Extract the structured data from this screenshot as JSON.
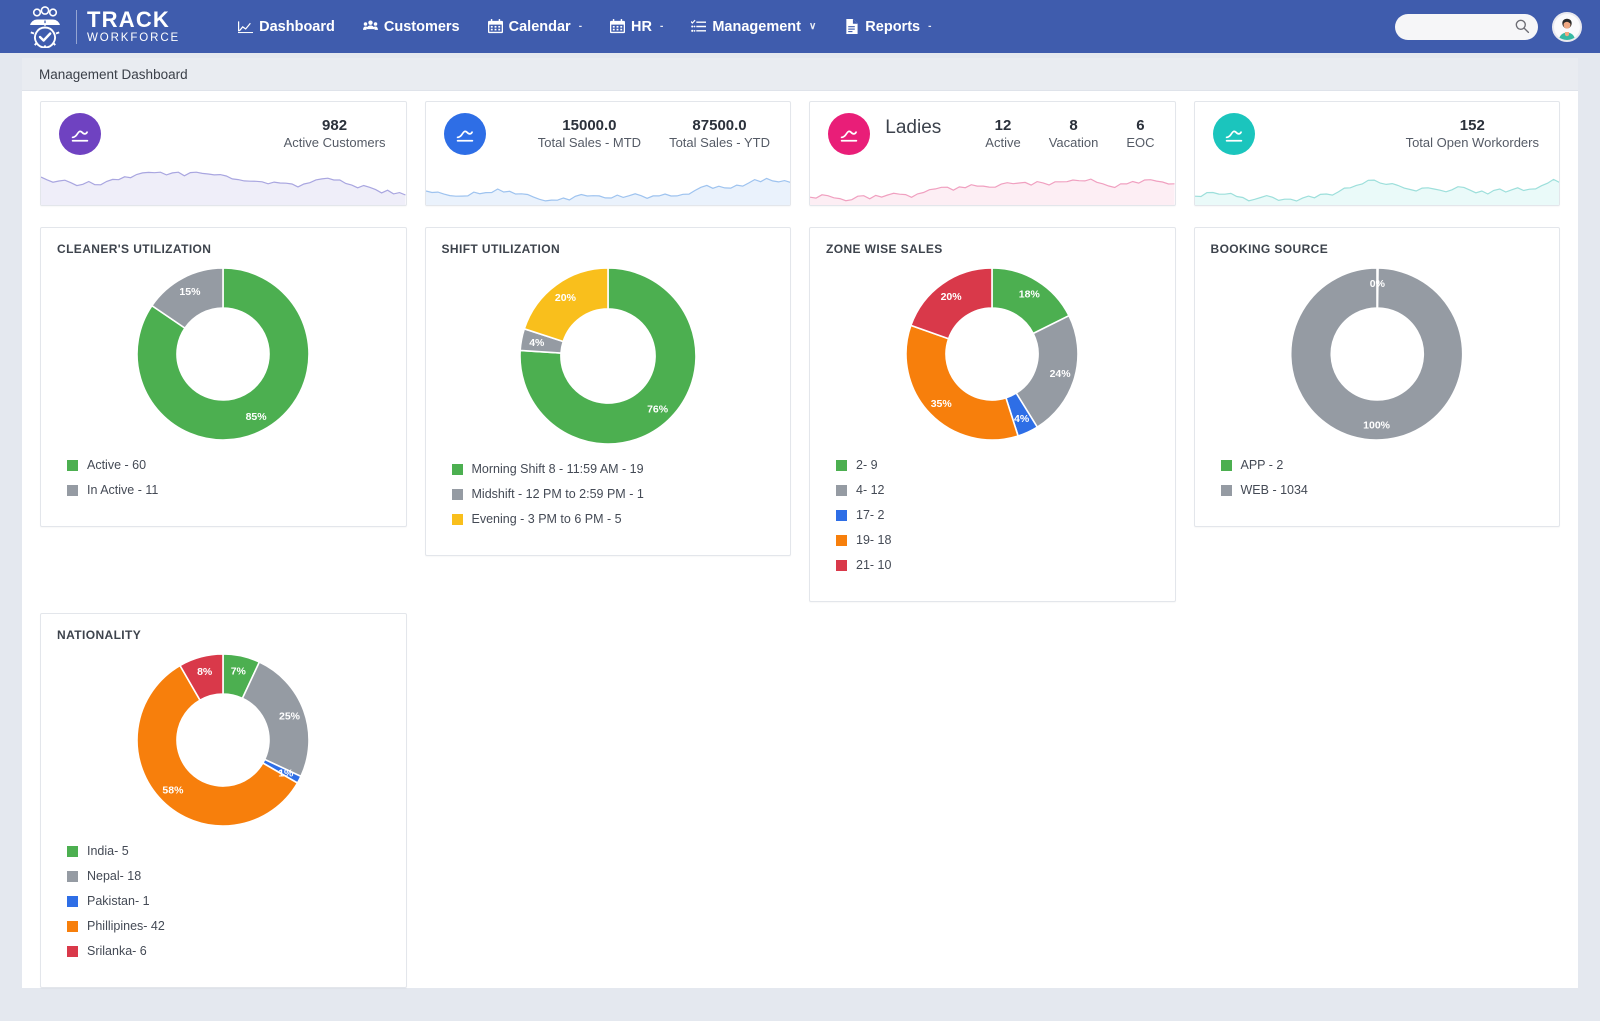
{
  "brand": {
    "icon": "workforce-people-gear-logo",
    "name_top": "TRACK",
    "name_sub": "WORKFORCE"
  },
  "nav": {
    "items": [
      {
        "label": "Dashboard",
        "icon": "chart-line-icon",
        "caret": ""
      },
      {
        "label": "Customers",
        "icon": "users-icon",
        "caret": ""
      },
      {
        "label": "Calendar",
        "icon": "calendar-icon",
        "caret": "-"
      },
      {
        "label": "HR",
        "icon": "calendar-icon",
        "caret": "-"
      },
      {
        "label": "Management",
        "icon": "list-check-icon",
        "caret": "∨"
      },
      {
        "label": "Reports",
        "icon": "file-icon",
        "caret": "-"
      }
    ]
  },
  "search": {
    "value": "",
    "placeholder": "",
    "icon": "search-icon"
  },
  "account": {
    "icon": "user-avatar"
  },
  "page": {
    "title": "Management Dashboard"
  },
  "kpis": [
    {
      "icon": "trend-up-icon",
      "color": "#6f42c1",
      "spark_color": "#a9a6e0",
      "spark_fill": "#efeef9",
      "stats": [
        {
          "value": "982",
          "label": "Active Customers"
        }
      ]
    },
    {
      "icon": "trend-up-icon",
      "color": "#2e6ee6",
      "spark_color": "#9ec3ef",
      "spark_fill": "#eaf2fc",
      "stats": [
        {
          "value": "15000.0",
          "label": "Total Sales - MTD"
        },
        {
          "value": "87500.0",
          "label": "Total Sales - YTD"
        }
      ]
    },
    {
      "icon": "trend-up-icon",
      "color": "#e91e78",
      "spark_color": "#f0a0c0",
      "spark_fill": "#fdeef4",
      "name": "Ladies",
      "stats": [
        {
          "value": "12",
          "label": "Active"
        },
        {
          "value": "8",
          "label": "Vacation"
        },
        {
          "value": "6",
          "label": "EOC"
        }
      ]
    },
    {
      "icon": "trend-up-icon",
      "color": "#1bc5bd",
      "spark_color": "#9ddfdb",
      "spark_fill": "#eafaf9",
      "stats": [
        {
          "value": "152",
          "label": "Total Open Workorders"
        }
      ]
    }
  ],
  "chart_data": [
    {
      "type": "pie",
      "title": "CLEANER'S UTILIZATION",
      "categories": [
        "Active",
        "In Active"
      ],
      "values": [
        60,
        11
      ],
      "percents": [
        "85%",
        "15%"
      ],
      "colors": [
        "#4caf50",
        "#959ba3"
      ],
      "legend": [
        {
          "label": "Active -  60",
          "color": "#4caf50"
        },
        {
          "label": "In Active -  11",
          "color": "#959ba3"
        }
      ],
      "legend_position": "bottom"
    },
    {
      "type": "pie",
      "title": "SHIFT UTILIZATION",
      "categories": [
        "Morning Shift 8 - 11:59 AM",
        "Midshift - 12 PM to 2:59 PM",
        "Evening - 3 PM to 6 PM"
      ],
      "values": [
        19,
        1,
        5
      ],
      "percents": [
        "76%",
        "4%",
        "20%"
      ],
      "colors": [
        "#4caf50",
        "#959ba3",
        "#f9bf1c"
      ],
      "legend": [
        {
          "label": "Morning Shift 8 - 11:59 AM -  19",
          "color": "#4caf50"
        },
        {
          "label": "Midshift - 12 PM to 2:59 PM -  1",
          "color": "#959ba3"
        },
        {
          "label": "Evening - 3 PM to 6 PM -  5",
          "color": "#f9bf1c"
        }
      ],
      "legend_position": "bottom"
    },
    {
      "type": "pie",
      "title": "ZONE WISE SALES",
      "categories": [
        "2",
        "4",
        "17",
        "19",
        "21"
      ],
      "values": [
        9,
        12,
        2,
        18,
        10
      ],
      "percents": [
        "18%",
        "24%",
        "4%",
        "35%",
        "20%"
      ],
      "colors": [
        "#4caf50",
        "#959ba3",
        "#2e6ee6",
        "#f77f0c",
        "#d9394a"
      ],
      "legend": [
        {
          "label": "2-  9",
          "color": "#4caf50"
        },
        {
          "label": "4-  12",
          "color": "#959ba3"
        },
        {
          "label": "17-  2",
          "color": "#2e6ee6"
        },
        {
          "label": "19-  18",
          "color": "#f77f0c"
        },
        {
          "label": "21-  10",
          "color": "#d9394a"
        }
      ],
      "legend_position": "bottom"
    },
    {
      "type": "pie",
      "title": "BOOKING SOURCE",
      "categories": [
        "APP",
        "WEB"
      ],
      "values": [
        2,
        1034
      ],
      "percents": [
        "0%",
        "100%"
      ],
      "colors": [
        "#4caf50",
        "#959ba3"
      ],
      "legend": [
        {
          "label": "APP -  2",
          "color": "#4caf50"
        },
        {
          "label": "WEB -  1034",
          "color": "#959ba3"
        }
      ],
      "legend_position": "bottom"
    },
    {
      "type": "pie",
      "title": "NATIONALITY",
      "categories": [
        "India",
        "Nepal",
        "Pakistan",
        "Phillipines",
        "Srilanka"
      ],
      "values": [
        5,
        18,
        1,
        42,
        6
      ],
      "percents": [
        "7%",
        "25%",
        "1%",
        "58%",
        "8%"
      ],
      "colors": [
        "#4caf50",
        "#959ba3",
        "#2e6ee6",
        "#f77f0c",
        "#d9394a"
      ],
      "legend": [
        {
          "label": "India-  5",
          "color": "#4caf50"
        },
        {
          "label": "Nepal-  18",
          "color": "#959ba3"
        },
        {
          "label": "Pakistan-  1",
          "color": "#2e6ee6"
        },
        {
          "label": "Phillipines-  42",
          "color": "#f77f0c"
        },
        {
          "label": "Srilanka-  6",
          "color": "#d9394a"
        }
      ],
      "legend_position": "bottom"
    }
  ]
}
